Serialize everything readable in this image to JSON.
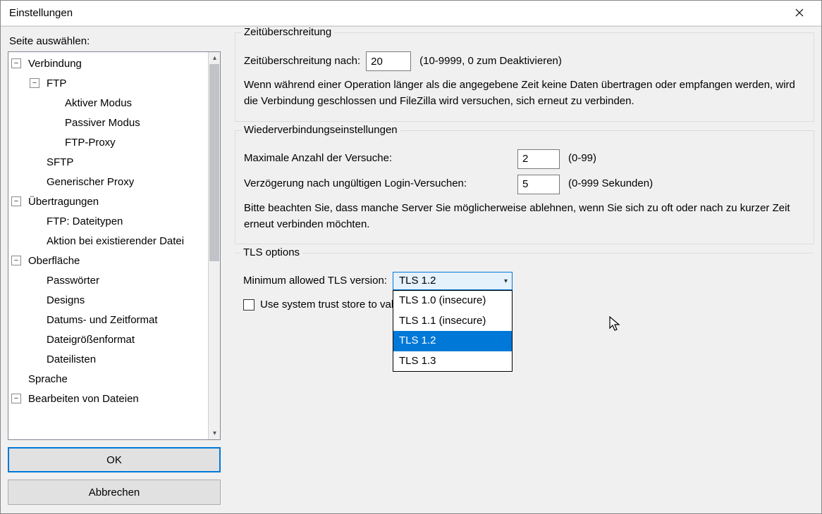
{
  "window": {
    "title": "Einstellungen"
  },
  "sidebar": {
    "label": "Seite auswählen:",
    "items": [
      {
        "label": "Verbindung",
        "level": 0,
        "expander": "−"
      },
      {
        "label": "FTP",
        "level": 1,
        "expander": "−"
      },
      {
        "label": "Aktiver Modus",
        "level": 2,
        "expander": ""
      },
      {
        "label": "Passiver Modus",
        "level": 2,
        "expander": ""
      },
      {
        "label": "FTP-Proxy",
        "level": 2,
        "expander": ""
      },
      {
        "label": "SFTP",
        "level": 1,
        "expander": ""
      },
      {
        "label": "Generischer Proxy",
        "level": 1,
        "expander": ""
      },
      {
        "label": "Übertragungen",
        "level": 0,
        "expander": "−"
      },
      {
        "label": "FTP: Dateitypen",
        "level": 1,
        "expander": ""
      },
      {
        "label": "Aktion bei existierender Datei",
        "level": 1,
        "expander": ""
      },
      {
        "label": "Oberfläche",
        "level": 0,
        "expander": "−"
      },
      {
        "label": "Passwörter",
        "level": 1,
        "expander": ""
      },
      {
        "label": "Designs",
        "level": 1,
        "expander": ""
      },
      {
        "label": "Datums- und Zeitformat",
        "level": 1,
        "expander": ""
      },
      {
        "label": "Dateigrößenformat",
        "level": 1,
        "expander": ""
      },
      {
        "label": "Dateilisten",
        "level": 1,
        "expander": ""
      },
      {
        "label": "Sprache",
        "level": 0,
        "expander": ""
      },
      {
        "label": "Bearbeiten von Dateien",
        "level": 0,
        "expander": "−"
      }
    ]
  },
  "buttons": {
    "ok": "OK",
    "cancel": "Abbrechen"
  },
  "timeout": {
    "legend": "Zeitüberschreitung",
    "label": "Zeitüberschreitung nach:",
    "value": "20",
    "hint": "(10-9999, 0 zum Deaktivieren)",
    "desc": "Wenn während einer Operation länger als die angegebene Zeit keine Daten übertragen oder empfangen werden, wird die Verbindung geschlossen und FileZilla wird versuchen, sich erneut zu verbinden."
  },
  "reconnect": {
    "legend": "Wiederverbindungseinstellungen",
    "max_label": "Maximale Anzahl der Versuche:",
    "max_value": "2",
    "max_hint": "(0-99)",
    "delay_label": "Verzögerung nach ungültigen Login-Versuchen:",
    "delay_value": "5",
    "delay_hint": "(0-999 Sekunden)",
    "desc": "Bitte beachten Sie, dass manche Server Sie möglicherweise ablehnen, wenn Sie sich zu oft oder nach zu kurzer Zeit erneut verbinden möchten."
  },
  "tls": {
    "legend": "TLS options",
    "min_label": "Minimum allowed TLS version:",
    "selected": "TLS 1.2",
    "options": [
      "TLS 1.0 (insecure)",
      "TLS 1.1 (insecure)",
      "TLS 1.2",
      "TLS 1.3"
    ],
    "selected_index": 2,
    "trust_label_visible": "Use system trust store to val",
    "trust_checked": false
  }
}
